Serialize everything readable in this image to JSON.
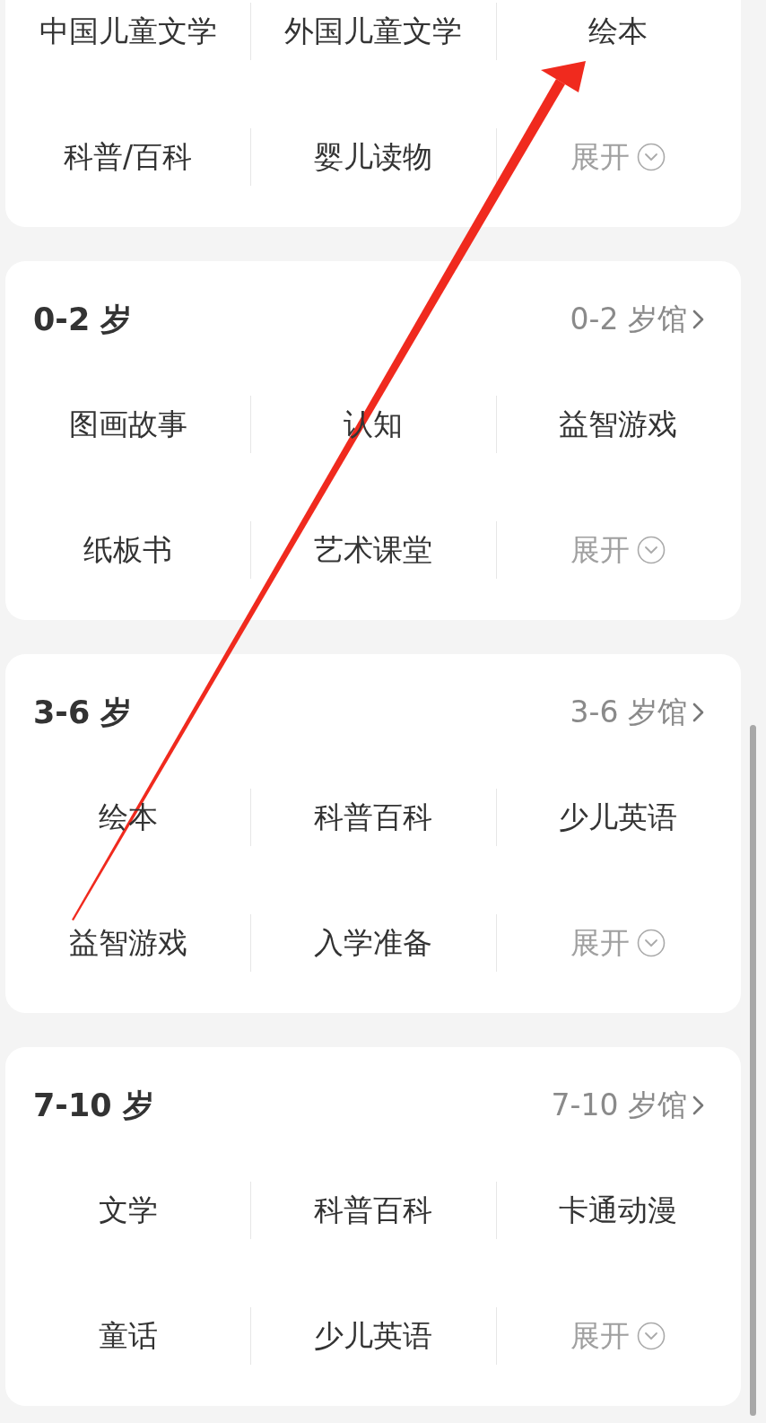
{
  "sections": [
    {
      "categories": [
        {
          "kind": "category",
          "label": "中国儿童文学"
        },
        {
          "kind": "category",
          "label": "外国儿童文学"
        },
        {
          "kind": "category",
          "label": "绘本"
        },
        {
          "kind": "category",
          "label": "科普/百科"
        },
        {
          "kind": "category",
          "label": "婴儿读物"
        },
        {
          "kind": "expand",
          "label": "展开"
        }
      ]
    },
    {
      "title": "0-2 岁",
      "link": "0-2 岁馆",
      "categories": [
        {
          "kind": "category",
          "label": "图画故事"
        },
        {
          "kind": "category",
          "label": "认知"
        },
        {
          "kind": "category",
          "label": "益智游戏"
        },
        {
          "kind": "category",
          "label": "纸板书"
        },
        {
          "kind": "category",
          "label": "艺术课堂"
        },
        {
          "kind": "expand",
          "label": "展开"
        }
      ]
    },
    {
      "title": "3-6 岁",
      "link": "3-6 岁馆",
      "categories": [
        {
          "kind": "category",
          "label": "绘本"
        },
        {
          "kind": "category",
          "label": "科普百科"
        },
        {
          "kind": "category",
          "label": "少儿英语"
        },
        {
          "kind": "category",
          "label": "益智游戏"
        },
        {
          "kind": "category",
          "label": "入学准备"
        },
        {
          "kind": "expand",
          "label": "展开"
        }
      ]
    },
    {
      "title": "7-10 岁",
      "link": "7-10 岁馆",
      "categories": [
        {
          "kind": "category",
          "label": "文学"
        },
        {
          "kind": "category",
          "label": "科普百科"
        },
        {
          "kind": "category",
          "label": "卡通动漫"
        },
        {
          "kind": "category",
          "label": "童话"
        },
        {
          "kind": "category",
          "label": "少儿英语"
        },
        {
          "kind": "expand",
          "label": "展开"
        }
      ]
    }
  ]
}
